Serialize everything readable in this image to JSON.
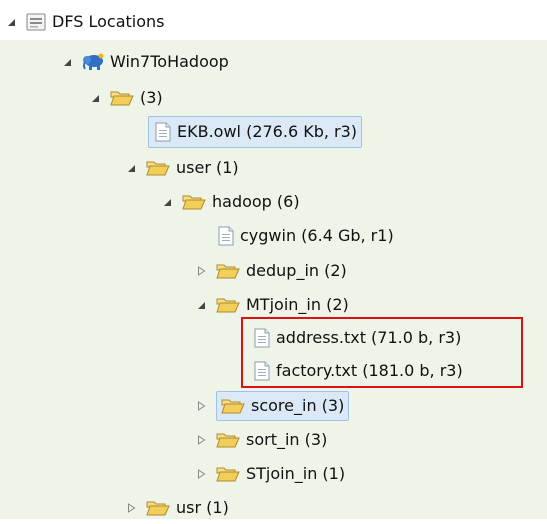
{
  "tree": {
    "root": {
      "label": "DFS Locations",
      "icon": "dfs-locations-icon"
    },
    "location": {
      "label": "Win7ToHadoop",
      "icon": "elephant-icon"
    },
    "top_folder": {
      "label": "(3)"
    },
    "ekb_file": {
      "label": "EKB.owl (276.6 Kb, r3)"
    },
    "user_folder": {
      "label": "user (1)"
    },
    "hadoop_folder": {
      "label": "hadoop (6)"
    },
    "cygwin_file": {
      "label": "cygwin (6.4 Gb, r1)"
    },
    "dedup_folder": {
      "label": "dedup_in (2)"
    },
    "mtjoin_folder": {
      "label": "MTjoin_in (2)"
    },
    "address_file": {
      "label": "address.txt (71.0 b, r3)"
    },
    "factory_file": {
      "label": "factory.txt (181.0 b, r3)"
    },
    "score_folder": {
      "label": "score_in (3)"
    },
    "sort_folder": {
      "label": "sort_in (3)"
    },
    "stjoin_folder": {
      "label": "STjoin_in (1)"
    },
    "usr_folder": {
      "label": "usr (1)"
    }
  },
  "colors": {
    "highlight_border": "#e01010",
    "selection_bg": "#dbe9f7",
    "folder_yellow": "#f2cf5b",
    "panel_green": "#eef5e8"
  }
}
